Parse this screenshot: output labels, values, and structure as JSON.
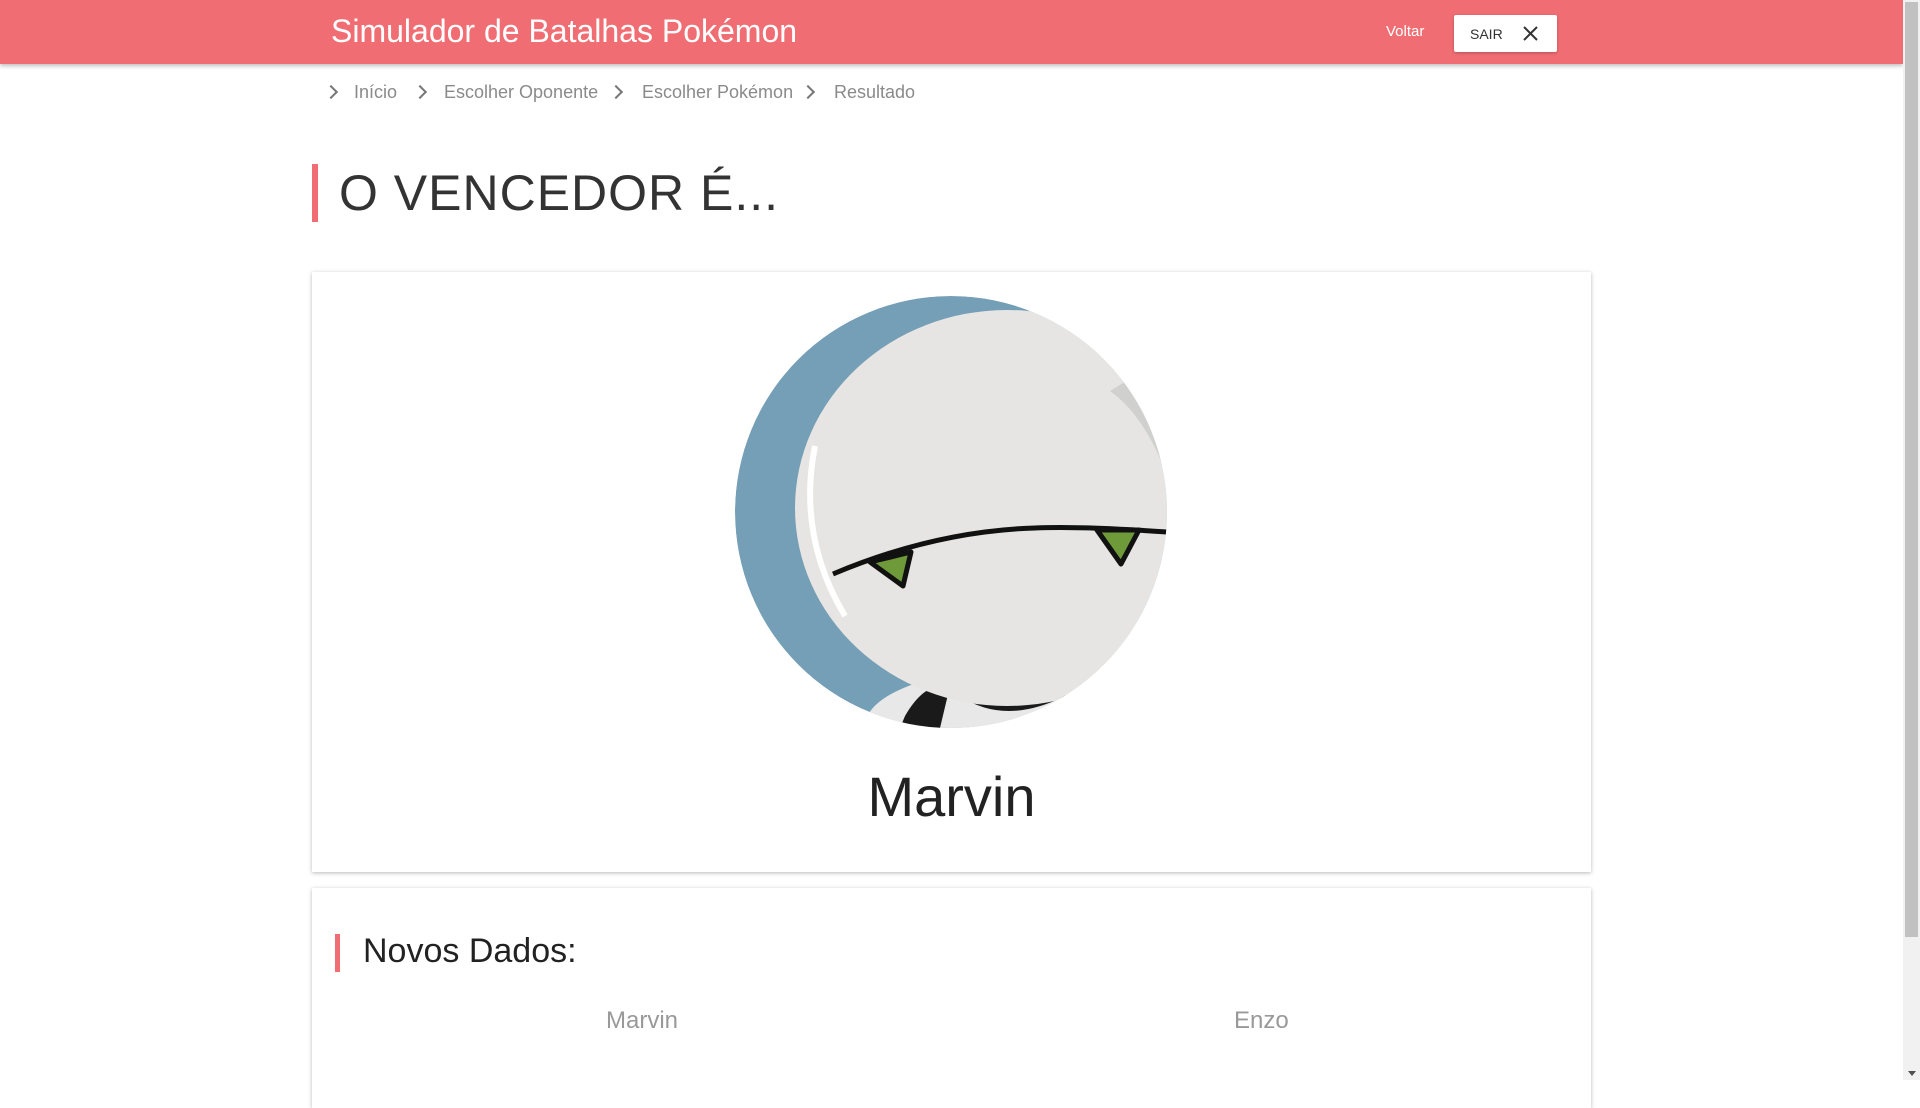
{
  "header": {
    "title": "Simulador de Batalhas Pokémon",
    "back_label": "Voltar",
    "exit_label": "SAIR",
    "accent": "#f06e73"
  },
  "breadcrumb": [
    "Início",
    "Escolher Oponente",
    "Escolher Pokémon",
    "Resultado"
  ],
  "page_title": "O VENCEDOR É...",
  "winner": {
    "name": "Marvin",
    "avatar_icon": "marvin-robot-avatar"
  },
  "stats": {
    "title": "Novos Dados:",
    "players": [
      "Marvin",
      "Enzo"
    ]
  }
}
